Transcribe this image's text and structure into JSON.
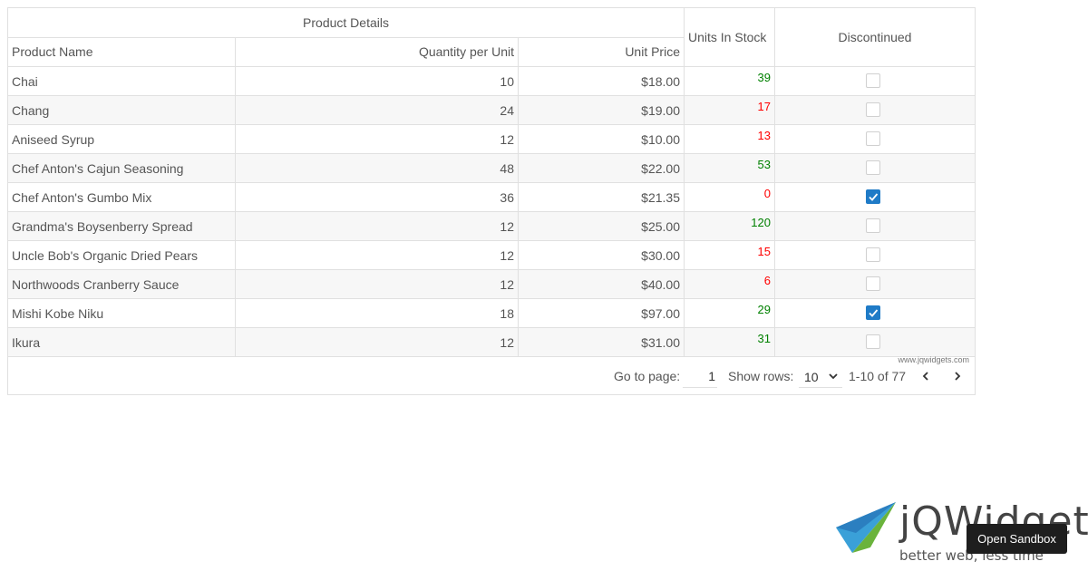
{
  "grid": {
    "group_header": "Product Details",
    "columns": {
      "product_name": "Product Name",
      "quantity_per_unit": "Quantity per Unit",
      "unit_price": "Unit Price",
      "units_in_stock": "Units In Stock",
      "discontinued": "Discontinued"
    },
    "rows": [
      {
        "name": "Chai",
        "qty": "10",
        "price": "$18.00",
        "stock": "39",
        "stock_status": "high",
        "discontinued": false
      },
      {
        "name": "Chang",
        "qty": "24",
        "price": "$19.00",
        "stock": "17",
        "stock_status": "low",
        "discontinued": false
      },
      {
        "name": "Aniseed Syrup",
        "qty": "12",
        "price": "$10.00",
        "stock": "13",
        "stock_status": "low",
        "discontinued": false
      },
      {
        "name": "Chef Anton's Cajun Seasoning",
        "qty": "48",
        "price": "$22.00",
        "stock": "53",
        "stock_status": "high",
        "discontinued": false
      },
      {
        "name": "Chef Anton's Gumbo Mix",
        "qty": "36",
        "price": "$21.35",
        "stock": "0",
        "stock_status": "low",
        "discontinued": true
      },
      {
        "name": "Grandma's Boysenberry Spread",
        "qty": "12",
        "price": "$25.00",
        "stock": "120",
        "stock_status": "high",
        "discontinued": false
      },
      {
        "name": "Uncle Bob's Organic Dried Pears",
        "qty": "12",
        "price": "$30.00",
        "stock": "15",
        "stock_status": "low",
        "discontinued": false
      },
      {
        "name": "Northwoods Cranberry Sauce",
        "qty": "12",
        "price": "$40.00",
        "stock": "6",
        "stock_status": "low",
        "discontinued": false
      },
      {
        "name": "Mishi Kobe Niku",
        "qty": "18",
        "price": "$97.00",
        "stock": "29",
        "stock_status": "high",
        "discontinued": true
      },
      {
        "name": "Ikura",
        "qty": "12",
        "price": "$31.00",
        "stock": "31",
        "stock_status": "high",
        "discontinued": false
      }
    ],
    "watermark": "www.jqwidgets.com",
    "colors": {
      "stock_high": "#008000",
      "stock_low": "#ff0000",
      "checkbox_checked": "#1f7bc7"
    }
  },
  "pager": {
    "goto_label": "Go to page:",
    "page_value": "1",
    "show_rows_label": "Show rows:",
    "rows_value": "10",
    "range_text": "1-10 of 77",
    "prev_icon": "chevron-left-icon",
    "next_icon": "chevron-right-icon"
  },
  "branding": {
    "brand": "jQWidgets",
    "tagline": "better web, less time",
    "sandbox_button": "Open Sandbox"
  }
}
